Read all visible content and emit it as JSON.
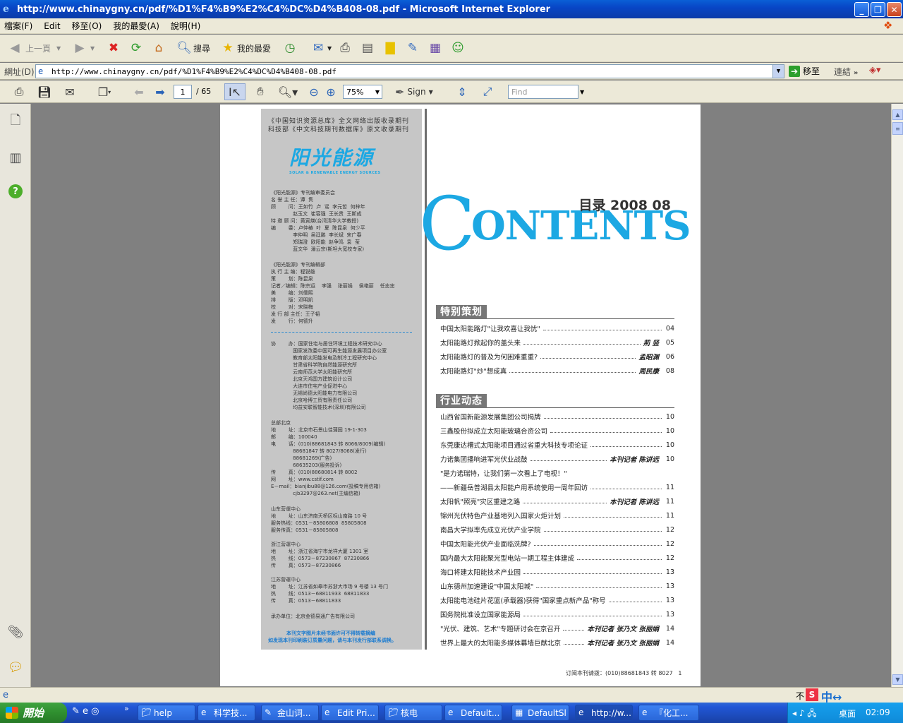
{
  "window": {
    "title": "http://www.chinaygny.cn/pdf/%D1%F4%B9%E2%C4%DC%D4%B408-08.pdf - Microsoft Internet Explorer"
  },
  "menu": [
    "檔案(F)",
    "Edit",
    "移至(O)",
    "我的最愛(A)",
    "說明(H)"
  ],
  "toolbar": {
    "back": "上一頁",
    "search": "搜尋",
    "favorites": "我的最愛"
  },
  "address": {
    "label": "網址(D)",
    "url": "http://www.chinaygny.cn/pdf/%D1%F4%B9%E2%C4%DC%D4%B408-08.pdf",
    "go": "移至",
    "links": "連結"
  },
  "pdf_toolbar": {
    "page_current": "1",
    "page_total": "/ 65",
    "zoom": "75%",
    "sign": "Sign",
    "find_placeholder": "Find"
  },
  "page": {
    "masthead_line1": "《中国知识资源总库》全文网络出版收录期刊",
    "masthead_line2": "科技部《中文科技期刊数据库》原文收录期刊",
    "logo_text": "阳光能源",
    "logo_sub": "SOLAR & RENEWABLE ENERGY SOURCES",
    "committee_text": "《阳光能源》专刊编审委员会\n名 誉 主 任：谭  隽\n顾        问：王如竹  卢  谣  李元哲  何梓年\n              赵玉文  崔容强  王长贵  王斯成\n特 邀 顾 问：黄寅煐(台湾清华大学教授)\n编        委：卢仲椿  叶  夏  陈昆泉  何少平\n              李仲明  吴廷鹏  李长斌  宋广春\n              郑瑞澄  欧阳能  赵争鸣  袁  莹\n              蓝文华  潘云宗(斯坦大宽校专家)",
    "editorial_text": "《阳光能源》专刊编辑部\n执 行 主 编：程锐雄\n策        划：陈昆泉\n记者／编辑：陈宗运    李强    张丽娟    侯艳丽    任志忠\n美        编：刘儒熙\n排        版：邓明凯\n校        对：宋晓梅\n发 行 部 主任：王子韬\n发        行：何德升",
    "cohost_text": "协        办：国家住宅与居住环境工程技术研究中心\n              国家发改委中国可再生能源发展项目办公室\n              教育部太阳能发电及制冷工程研究中心\n              甘肃省科学院自然能源研究所\n              云南师范大学太阳能研究所\n              北京天鸿国方建筑设计公司\n              大连市住宅产业促进中心\n              无锡尚德太阳能电力有限公司\n              北京哈博工贸有限责任公司\n              均益安联智能技术(深圳)有限公司",
    "hq_text": "总部北京\n地        址：北京市石景山佳蒲园 19-1-303\n邮        编：100040\n电        话：(010)88681843 转 8066/8009(编辑)\n              88681847 转 8027/8068(发行)\n              88681269(广告)\n              68635203(服务投诉)\n传        真：(010)88680814 转 8002\n网        址：www.cstif.com\nE－mail：bianjibu88@126.com(投稿专用信箱)\n              cjb3297@263.net(主编信箱)",
    "shandong_text": "山东营運中心\n地        址：山东济南天桥区标山南路 10 号\n服务热线：0531－85806808  85805808\n服务传真：0531－85805808",
    "zhejiang_text": "浙江营運中心\n地        址：浙江省海宁市龙祥大厦 1301 室\n热        线：0573－87230867  87230866\n传        真：0573－87230866",
    "jiangsu_text": "江苏营運中心\n地        址：江苏省如皋市苏浙大市场 9 号楼 13 号门\n热        线：0513－68811933  68811833\n传        真：0513－68811833",
    "publisher_text": "承办单位：北京金德易通广告有限公司",
    "notice_line1": "本刊文字图片未经书面许可不得转载摘编",
    "notice_line2": "如发现本刊印刷装订质量问题，请与本刊发行部联系调换。",
    "contents_c": "C",
    "contents_rest": "ONTENTS",
    "issue": "目录 2008 08",
    "section1": "特别策划",
    "section2": "行业动态",
    "toc1": [
      {
        "title": "中国太阳能路灯\"让我欢喜让我忧\"",
        "author": "",
        "page": "04"
      },
      {
        "title": "太阳能路灯掀起你的盖头来",
        "author": "荊  竖",
        "page": "05"
      },
      {
        "title": "太阳能路灯的普及为何困难重重?",
        "author": "孟昭渊",
        "page": "06"
      },
      {
        "title": "太阳能路灯\"炒\"想成真",
        "author": "周民康",
        "page": "08"
      }
    ],
    "toc2": [
      {
        "title": "山西省国新能源发展集团公司揭牌",
        "author": "",
        "page": "10"
      },
      {
        "title": "三鑫股份拟成立太阳能玻璃合资公司",
        "author": "",
        "page": "10"
      },
      {
        "title": "东莞康达槽式太阳能项目通过省重大科技专项论证",
        "author": "",
        "page": "10"
      },
      {
        "title": "力诺集团播响进军光伏业战鼓",
        "author": "本刊记者   陈讲远",
        "page": "10"
      },
      {
        "title": "\"是力诺瑞特，让我们第一次看上了电视！\"",
        "author": "",
        "page": ""
      },
      {
        "title": "      ——新疆岳普湖县太阳能户用系统使用一周年回访",
        "author": "",
        "page": "11"
      },
      {
        "title": "太阳帆\"照亮\"灾区重建之路",
        "author": "本刊记者   陈讲远",
        "page": "11"
      },
      {
        "title": "锦州光伏特色产业基地列入国家火炬计划",
        "author": "",
        "page": "11"
      },
      {
        "title": "南昌大学拟率先成立光伏产业学院",
        "author": "",
        "page": "12"
      },
      {
        "title": "中国太阳能光伏产业面临洗牌?",
        "author": "",
        "page": "12"
      },
      {
        "title": "国内最大太阳能聚光型电站一期工程主体建成",
        "author": "",
        "page": "12"
      },
      {
        "title": "海口将建太阳能技术产业园",
        "author": "",
        "page": "13"
      },
      {
        "title": "山东德州加速建设\"中国太阳城\"",
        "author": "",
        "page": "13"
      },
      {
        "title": "太阳能电池硅片花篮(承载器)获得\"国家重点新产品\"称号",
        "author": "",
        "page": "13"
      },
      {
        "title": "国务院批准设立国家能源局",
        "author": "",
        "page": "13"
      },
      {
        "title": "\"光伏、建筑、艺术\"专题研讨会在京召开",
        "author": "本刊记者   张乃文   张丽娟",
        "page": "14"
      },
      {
        "title": "世界上最大的太阳能多媒体幕墙巨献北京",
        "author": "本刊记者   张乃文   张丽娟",
        "page": "14"
      }
    ],
    "subscribe": "订阅本刊请拨：(010)88681843 转 8027",
    "page_number": "1"
  },
  "statusbar": {
    "left_icon": "ie-page-icon",
    "right_text": "不"
  },
  "taskbar": {
    "start": "開始",
    "tasks": [
      "help",
      "科学技...",
      "金山词...",
      "Edit Pri...",
      "核电",
      "Default...",
      "DefaultSl",
      "http://w...",
      "『化工..."
    ],
    "tray_label": "桌面",
    "clock": "02:09"
  }
}
